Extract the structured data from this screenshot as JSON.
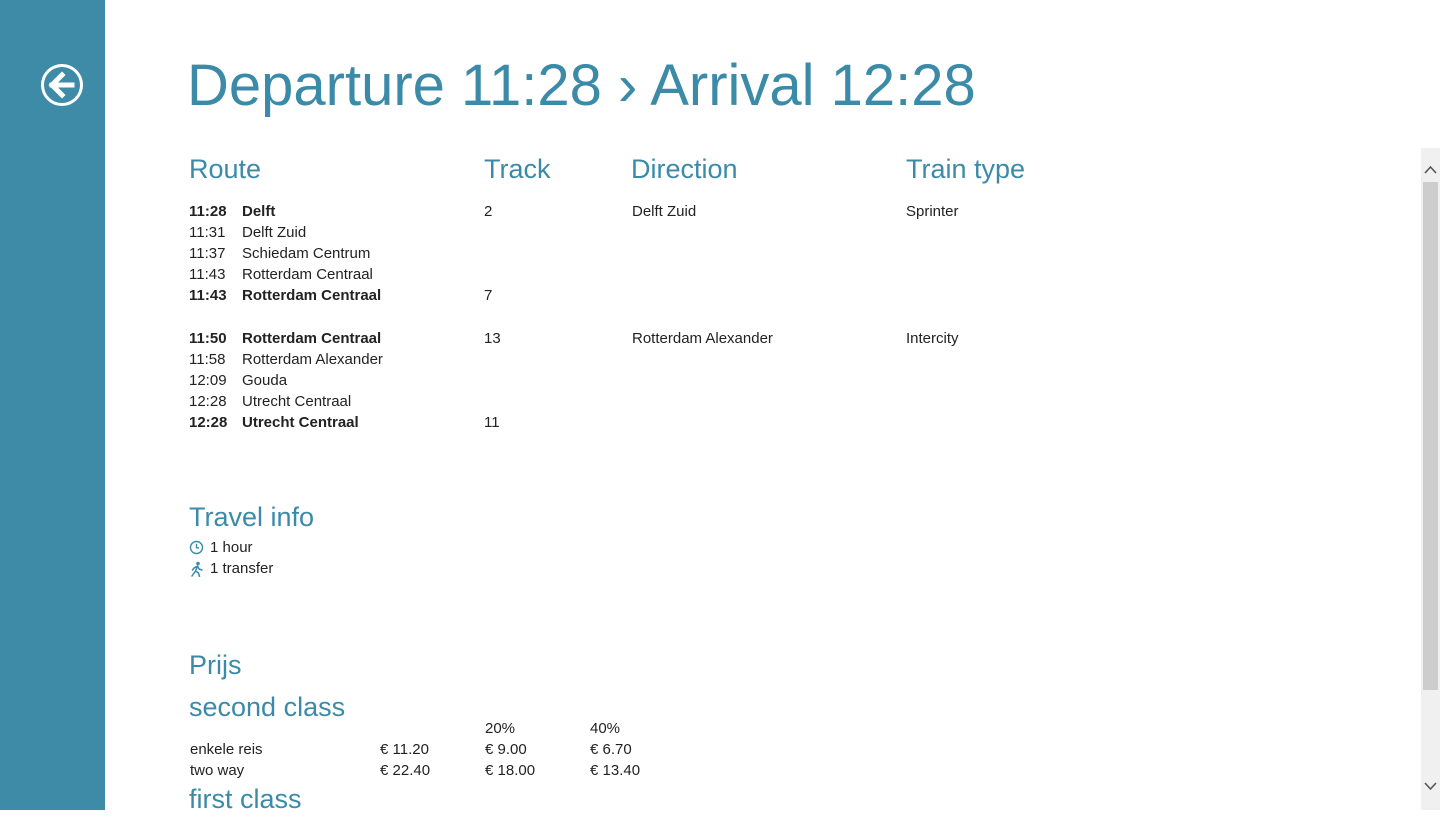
{
  "title": "Departure 11:28 › Arrival 12:28",
  "headers": {
    "route": "Route",
    "track": "Track",
    "direction": "Direction",
    "train_type": "Train type"
  },
  "legs": [
    {
      "stops": [
        {
          "time": "11:28",
          "station": "Delft",
          "bold": true,
          "track": "2"
        },
        {
          "time": "11:31",
          "station": "Delft Zuid",
          "bold": false,
          "track": ""
        },
        {
          "time": "11:37",
          "station": "Schiedam Centrum",
          "bold": false,
          "track": ""
        },
        {
          "time": "11:43",
          "station": "Rotterdam Centraal",
          "bold": false,
          "track": ""
        },
        {
          "time": "11:43",
          "station": "Rotterdam Centraal",
          "bold": true,
          "track": "7"
        }
      ],
      "direction": "Delft Zuid",
      "train_type": "Sprinter"
    },
    {
      "stops": [
        {
          "time": "11:50",
          "station": "Rotterdam Centraal",
          "bold": true,
          "track": "13"
        },
        {
          "time": "11:58",
          "station": "Rotterdam Alexander",
          "bold": false,
          "track": ""
        },
        {
          "time": "12:09",
          "station": "Gouda",
          "bold": false,
          "track": ""
        },
        {
          "time": "12:28",
          "station": "Utrecht Centraal",
          "bold": false,
          "track": ""
        },
        {
          "time": "12:28",
          "station": "Utrecht Centraal",
          "bold": true,
          "track": "11"
        }
      ],
      "direction": "Rotterdam Alexander",
      "train_type": "Intercity"
    }
  ],
  "travel_info": {
    "heading": "Travel info",
    "duration": "1 hour",
    "duration_icon": "clock-icon",
    "transfers": "1 transfer",
    "transfers_icon": "walking-person-icon"
  },
  "price": {
    "heading": "Prijs",
    "second_class": {
      "heading": "second class",
      "discount_headers": [
        "20%",
        "40%"
      ],
      "rows": [
        {
          "label": "enkele reis",
          "full": "€ 11.20",
          "d20": "€ 9.00",
          "d40": "€ 6.70"
        },
        {
          "label": "two way",
          "full": "€ 22.40",
          "d20": "€ 18.00",
          "d40": "€ 13.40"
        }
      ]
    },
    "first_class": {
      "heading": "first class"
    }
  },
  "colors": {
    "sidebar": "#3e8ba8",
    "accent": "#3a8aa8",
    "scrollbar_track": "#f0f0f0",
    "scrollbar_thumb": "#cdcdcd"
  },
  "icons": {
    "back": "back-arrow-icon",
    "scroll_up": "chevron-up-icon",
    "scroll_down": "chevron-down-icon"
  }
}
